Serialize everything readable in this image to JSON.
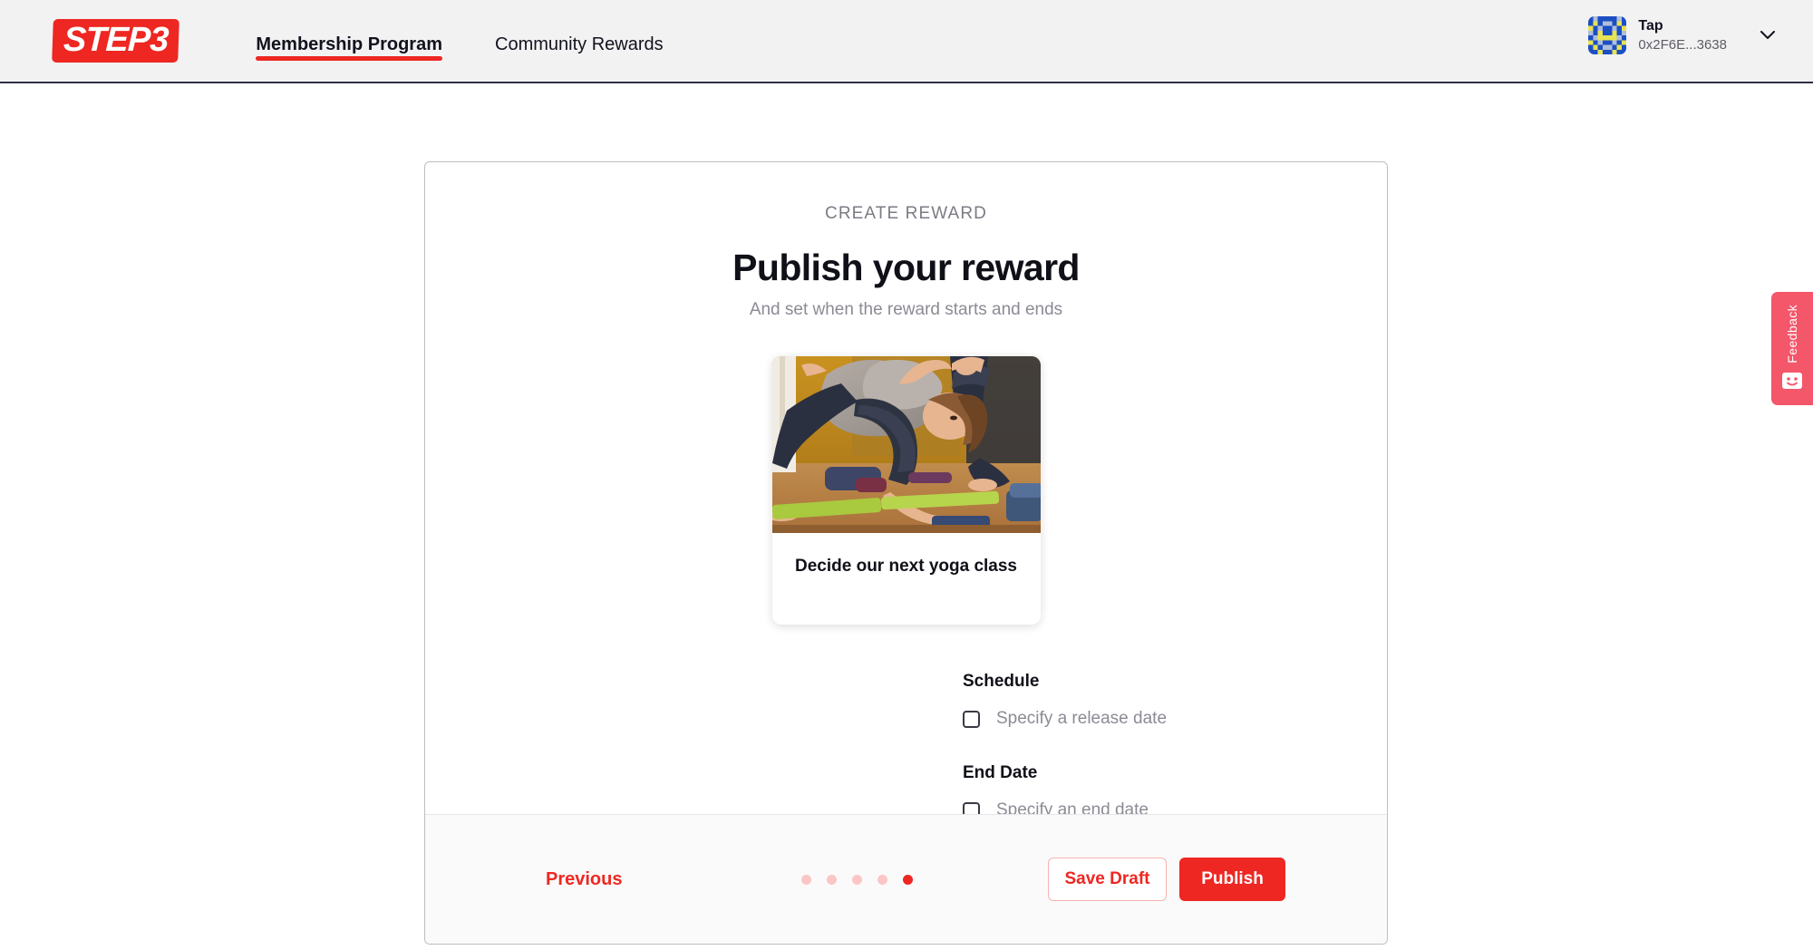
{
  "header": {
    "logo_text": "STEP3",
    "nav": [
      {
        "label": "Membership Program",
        "active": true
      },
      {
        "label": "Community Rewards",
        "active": false
      }
    ],
    "account": {
      "name": "Tap",
      "address": "0x2F6E...3638"
    }
  },
  "card": {
    "eyebrow": "CREATE REWARD",
    "title": "Publish your reward",
    "subtitle": "And set when the reward starts and ends",
    "reward": {
      "caption": "Decide our next yoga class",
      "image_alt": "yoga-class-photo"
    },
    "schedule": {
      "section_label": "Schedule",
      "checkbox_label": "Specify a release date",
      "checked": false
    },
    "end_date": {
      "section_label": "End Date",
      "checkbox_label": "Specify an end date",
      "checked": false
    },
    "footer": {
      "previous_label": "Previous",
      "save_draft_label": "Save Draft",
      "publish_label": "Publish",
      "step_count": 5,
      "active_step": 5
    }
  },
  "feedback": {
    "label": "Feedback"
  },
  "colors": {
    "brand_red": "#EE2722",
    "feedback_pink": "#F4566A",
    "header_bg": "#F2F2F2",
    "footer_bg": "#FAFAFA",
    "muted_text": "#8B8B95"
  }
}
